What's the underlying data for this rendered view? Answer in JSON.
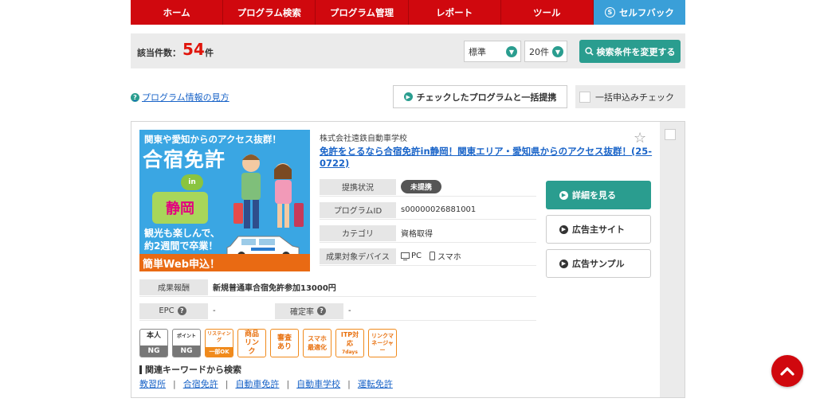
{
  "nav": {
    "items": [
      "ホーム",
      "プログラム検索",
      "プログラム管理",
      "レポート",
      "ツール"
    ],
    "self_back": "セルフバック"
  },
  "results": {
    "count_label": "該当件数：",
    "count": "54",
    "count_unit": "件",
    "sort_value": "標準",
    "per_page_value": "20件",
    "change_search_label": "検索条件を変更する"
  },
  "help": {
    "program_info_link": "プログラム情報の見方",
    "bulk_partner_label": "チェックしたプログラムと一括提携",
    "bulk_apply_check_label": "一括申込みチェック"
  },
  "program": {
    "banner": {
      "top_text": "関東や愛知からのアクセス抜群！",
      "title": "合宿免許",
      "in_text": "in",
      "pref": "静岡",
      "sub_line1": "観光も楽しんで、",
      "sub_line2": "約2週間で卒業！",
      "cta": "簡単Web申込！"
    },
    "advertiser": "株式会社遠鉄自動車学校",
    "title": "免許をとるなら合宿免許in静岡！関東エリア・愛知県からのアクセス抜群！(25-0722)",
    "info": {
      "status_label": "提携状況",
      "status_value": "未提携",
      "id_label": "プログラムID",
      "id_value": "s00000026881001",
      "category_label": "カテゴリ",
      "category_value": "資格取得",
      "device_label": "成果対象デバイス",
      "device_pc": "PC",
      "device_sp": "スマホ"
    },
    "reward_label": "成果報酬",
    "reward_value": "新規普通車合宿免許参加13000円",
    "epc_label": "EPC",
    "epc_value": "-",
    "confirm_label": "確定率",
    "confirm_value": "-",
    "buttons": {
      "detail": "詳細を見る",
      "advertiser_site": "広告主サイト",
      "ad_sample": "広告サンプル"
    },
    "tags": {
      "self_top": "本人",
      "self_ng": "NG",
      "point_top": "ポイント",
      "point_ng": "NG",
      "listing_top": "リスティング",
      "listing_foot": "一部OK",
      "product_link": "商品リンク",
      "review": "審査あり",
      "sp_opt": "スマホ最適化",
      "itp_top": "ITP対応",
      "itp_foot": "7days",
      "link_manager": "リンクマネージャー"
    },
    "keywords_title": "関連キーワードから検索",
    "keywords": [
      "教習所",
      "合宿免許",
      "自動車免許",
      "自動車学校",
      "運転免許"
    ]
  }
}
